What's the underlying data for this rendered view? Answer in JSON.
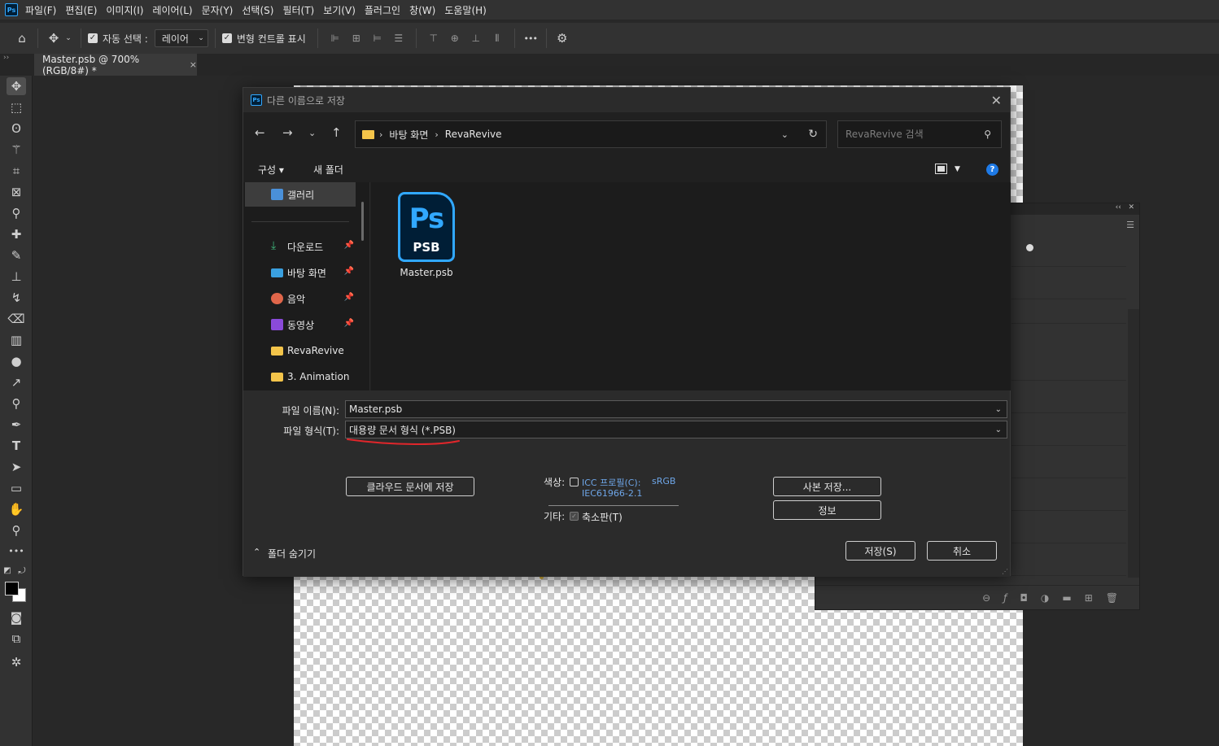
{
  "app": {
    "logo": "Ps",
    "menu": [
      "파일(F)",
      "편집(E)",
      "이미지(I)",
      "레이어(L)",
      "문자(Y)",
      "선택(S)",
      "필터(T)",
      "보기(V)",
      "플러그인",
      "창(W)",
      "도움말(H)"
    ]
  },
  "options": {
    "auto_select_label": "자동 선택 :",
    "auto_select_value": "레이어",
    "transform_label": "변형 컨트롤 표시",
    "more": "•••"
  },
  "document_tab": {
    "title": "Master.psb @ 700% (RGB/8#) *",
    "close": "×"
  },
  "dialog": {
    "logo": "Ps",
    "title": "다른 이름으로 저장",
    "close": "✕",
    "breadcrumb": [
      "바탕 화면",
      "RevaRevive"
    ],
    "search_placeholder": "RevaRevive 검색",
    "organize": "구성 ▾",
    "new_folder": "새 폴더",
    "help": "?",
    "nav_items": [
      {
        "name": "갤러리",
        "icon": "gallery-icon",
        "pinned": false
      },
      {
        "name": "다운로드",
        "icon": "download-icon",
        "pinned": true
      },
      {
        "name": "바탕 화면",
        "icon": "desktop-icon",
        "pinned": true
      },
      {
        "name": "음악",
        "icon": "music-icon",
        "pinned": true
      },
      {
        "name": "동영상",
        "icon": "video-icon",
        "pinned": true
      },
      {
        "name": "RevaRevive",
        "icon": "folder-icon",
        "pinned": false
      },
      {
        "name": "3. Animation",
        "icon": "folder-icon",
        "pinned": false
      }
    ],
    "file": {
      "icon_big": "Ps",
      "icon_small": "PSB",
      "name": "Master.psb"
    },
    "filename_label": "파일 이름(N):",
    "filename_value": "Master.psb",
    "format_label": "파일 형식(T):",
    "format_value": "대용량 문서 형식 (*.PSB)",
    "cloud_button": "클라우드 문서에 저장",
    "color_label": "색상:",
    "icc_label": "ICC 프로필(C):",
    "icc_value_1": "sRGB",
    "icc_value_2": "IEC61966-2.1",
    "other_label": "기타:",
    "thumbnail_label": "축소판(T)",
    "copy_button": "사본 저장...",
    "info_button": "정보",
    "save_button": "저장(S)",
    "cancel_button": "취소",
    "hide_folders": "폴더 숨기기"
  },
  "colors": {
    "accent": "#31a8ff",
    "annotation": "#e0262b",
    "link": "#6ea6e8"
  }
}
